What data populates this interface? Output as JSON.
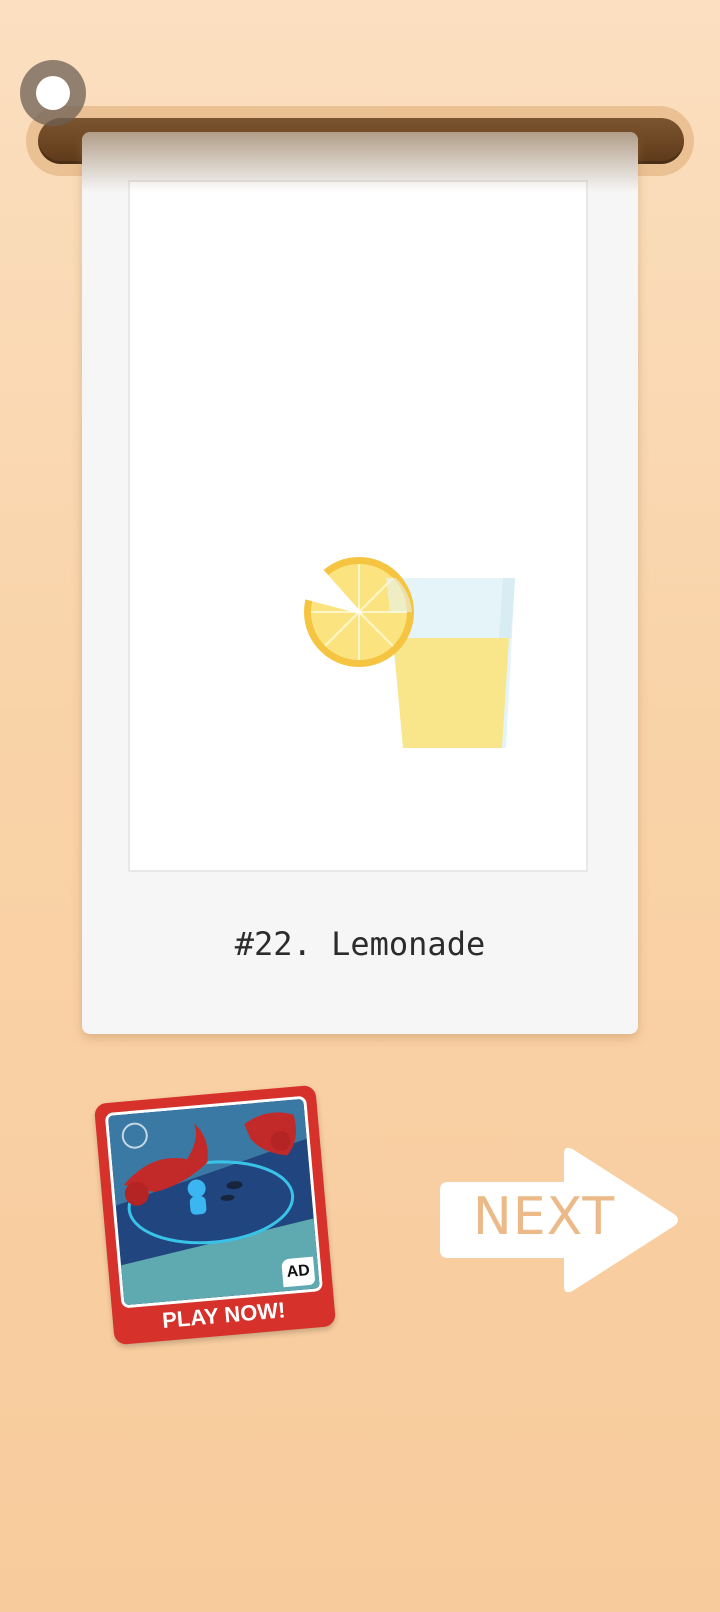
{
  "puzzle": {
    "caption": "#22. Lemonade"
  },
  "ad": {
    "badge": "AD",
    "cta": "PLAY NOW!"
  },
  "navigation": {
    "next_label": "NEXT"
  },
  "colors": {
    "background": "#f9d3a8",
    "rod": "#6b4422",
    "card": "#f6f6f6",
    "lemon": "#f8d649",
    "lemonade": "#f9e58a",
    "glass": "#e4f3f8",
    "ad_frame": "#d6312a",
    "next_text": "#ecba88"
  },
  "icons": {
    "knob": "pin-knob-icon",
    "next": "arrow-right-icon"
  }
}
